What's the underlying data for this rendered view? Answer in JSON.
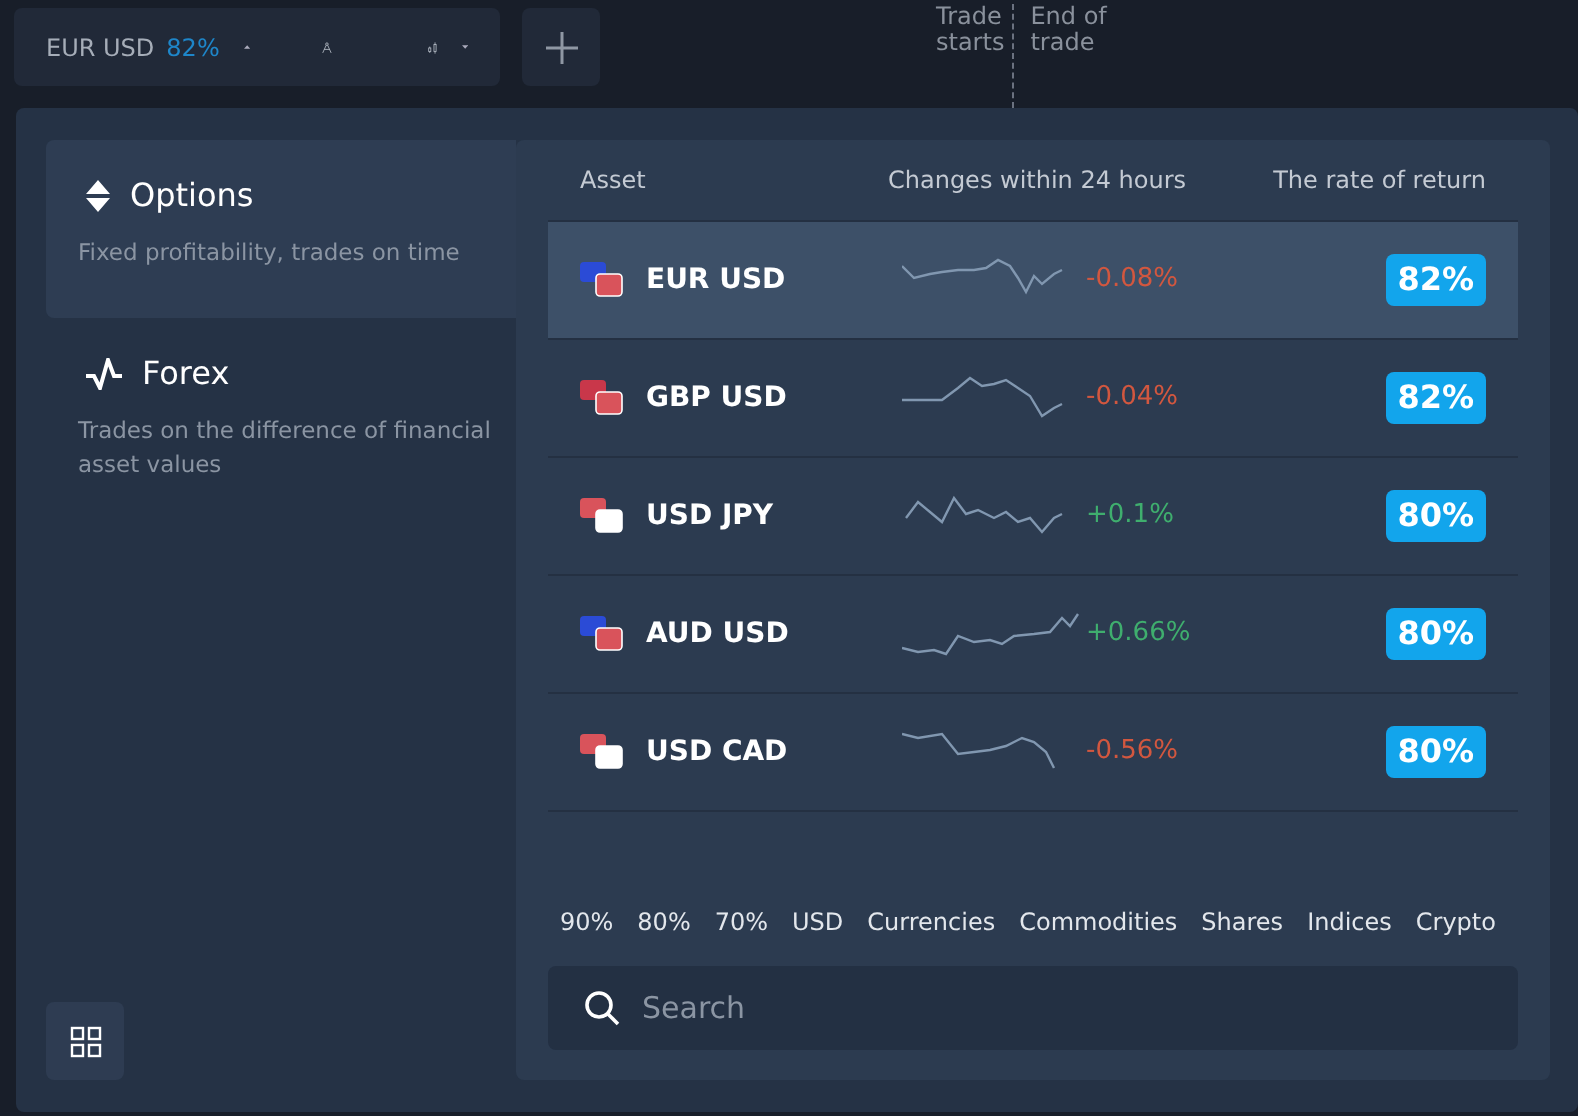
{
  "toolbar": {
    "asset": "EUR USD",
    "payout": "82%"
  },
  "chart_labels": {
    "start": "Trade\nstarts",
    "end": "End of\ntrade"
  },
  "categories": [
    {
      "kind": "options",
      "title": "Options",
      "description": "Fixed profitability, trades on time",
      "selected": true
    },
    {
      "kind": "forex",
      "title": "Forex",
      "description": "Trades on the difference of financial asset values",
      "selected": false
    }
  ],
  "table": {
    "columns": [
      "Asset",
      "Changes within 24 hours",
      "The rate of return"
    ],
    "rows": [
      {
        "asset": "EUR USD",
        "change": "-0.08%",
        "color": "#d2573f",
        "return": "82%",
        "selected": true
      },
      {
        "asset": "GBP USD",
        "change": "-0.04%",
        "color": "#d2573f",
        "return": "82%",
        "selected": false
      },
      {
        "asset": "USD JPY",
        "change": "+0.1%",
        "color": "#3fae6e",
        "return": "80%",
        "selected": false
      },
      {
        "asset": "AUD USD",
        "change": "+0.66%",
        "color": "#3fae6e",
        "return": "80%",
        "selected": false
      },
      {
        "asset": "USD CAD",
        "change": "-0.56%",
        "color": "#d2573f",
        "return": "80%",
        "selected": false
      }
    ]
  },
  "filters": [
    "90%",
    "80%",
    "70%",
    "USD",
    "Currencies",
    "Commodities",
    "Shares",
    "Indices",
    "Crypto"
  ],
  "search": {
    "placeholder": "Search"
  }
}
